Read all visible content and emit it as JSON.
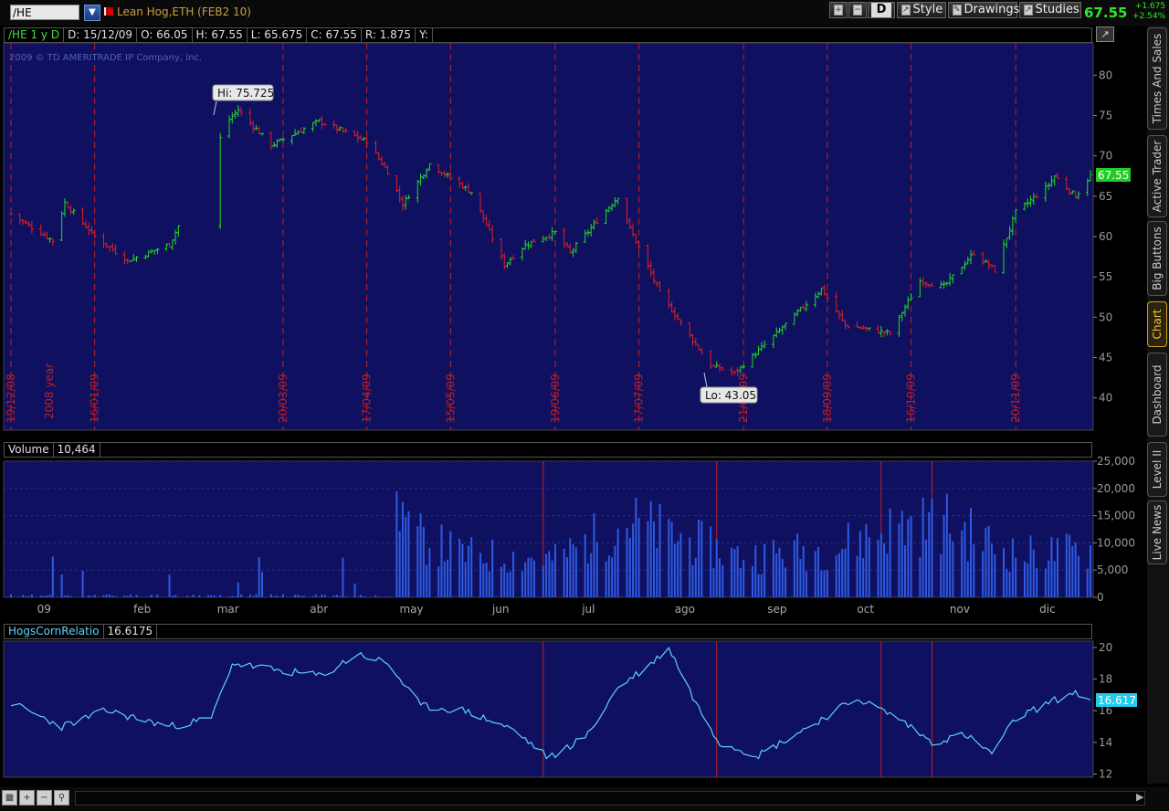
{
  "toolbar": {
    "symbol": "/HE",
    "instrument": "Lean Hog,ETH (FEB2 10)",
    "aggregation_label": "D",
    "style_label": "Style",
    "drawings_label": "Drawings",
    "studies_label": "Studies",
    "last_price": "67.55",
    "net_change": "+1.675",
    "pct_change": "+2.54%"
  },
  "price_header": {
    "symbol_period": "/HE 1 y D",
    "date": "D: 15/12/09",
    "open": "O: 66.05",
    "high": "H: 67.55",
    "low": "L: 65.675",
    "close": "C: 67.55",
    "range": "R: 1.875",
    "y": "Y:"
  },
  "copyright": "2009 © TD AMERITRADE IP Company, Inc.",
  "annotations": {
    "hi_label": "Hi: 75.725",
    "lo_label": "Lo: 43.05",
    "last_badge": "67.55",
    "ratio_badge": "16.617",
    "year_label": "2008 year"
  },
  "volume_header": {
    "label": "Volume",
    "value": "10,464"
  },
  "study_header": {
    "label": "HogsCornRelatio",
    "value": "16.6175"
  },
  "side_tabs": [
    "Times And Sales",
    "Active Trader",
    "Big Buttons",
    "Chart",
    "Dashboard",
    "Level II",
    "Live News"
  ],
  "active_side_tab": "Chart",
  "colors": {
    "panel_bg": "#0f1060",
    "up": "#22dd22",
    "down": "#e02020",
    "volume": "#2e5ae0",
    "ratio": "#5fd0ff",
    "marker": "#c02020",
    "accent": "#2ee62e"
  },
  "chart_data": [
    {
      "type": "ohlc",
      "title": "/HE 1 y D",
      "y_ticks": [
        40,
        45,
        50,
        55,
        60,
        65,
        70,
        75,
        80
      ],
      "ylim": [
        36,
        84
      ],
      "date_markers": [
        "19/12/08",
        "16/01/09",
        "20/03/09",
        "17/04/09",
        "15/05/09",
        "19/06/09",
        "17/07/09",
        "21/08/09",
        "18/09/09",
        "16/10/09",
        "20/11/09"
      ],
      "price_anchors": [
        {
          "date": "2008-12-19",
          "close": 62.8
        },
        {
          "date": "2009-01-02",
          "close": 59.5
        },
        {
          "date": "2009-01-06",
          "close": 64.2
        },
        {
          "date": "2009-01-16",
          "close": 60.0
        },
        {
          "date": "2009-01-27",
          "close": 57.0
        },
        {
          "date": "2009-02-10",
          "close": 59.0
        },
        {
          "date": "2009-03-02",
          "close": 74.5
        },
        {
          "date": "2009-03-05",
          "close": 75.725
        },
        {
          "date": "2009-03-16",
          "close": 71.3
        },
        {
          "date": "2009-04-01",
          "close": 74.3
        },
        {
          "date": "2009-04-17",
          "close": 71.8
        },
        {
          "date": "2009-04-24",
          "close": 68.0
        },
        {
          "date": "2009-04-29",
          "close": 64.0
        },
        {
          "date": "2009-05-08",
          "close": 69.0
        },
        {
          "date": "2009-05-22",
          "close": 65.5
        },
        {
          "date": "2009-06-02",
          "close": 56.5
        },
        {
          "date": "2009-06-09",
          "close": 59.0
        },
        {
          "date": "2009-06-19",
          "close": 60.5
        },
        {
          "date": "2009-06-24",
          "close": 58.0
        },
        {
          "date": "2009-07-10",
          "close": 65.0
        },
        {
          "date": "2009-07-14",
          "close": 61.0
        },
        {
          "date": "2009-07-24",
          "close": 53.0
        },
        {
          "date": "2009-08-10",
          "close": 44.0
        },
        {
          "date": "2009-08-18",
          "close": 43.05
        },
        {
          "date": "2009-09-01",
          "close": 48.0
        },
        {
          "date": "2009-09-16",
          "close": 53.5
        },
        {
          "date": "2009-09-24",
          "close": 49.0
        },
        {
          "date": "2009-10-09",
          "close": 48.0
        },
        {
          "date": "2009-10-19",
          "close": 54.5
        },
        {
          "date": "2009-10-27",
          "close": 53.8
        },
        {
          "date": "2009-11-06",
          "close": 58.0
        },
        {
          "date": "2009-11-13",
          "close": 55.8
        },
        {
          "date": "2009-11-20",
          "close": 63.0
        },
        {
          "date": "2009-11-30",
          "close": 66.0
        },
        {
          "date": "2009-12-03",
          "close": 67.5
        },
        {
          "date": "2009-12-10",
          "close": 65.0
        },
        {
          "date": "2009-12-15",
          "close": 67.55
        }
      ]
    },
    {
      "type": "bar",
      "title": "Volume",
      "y_ticks": [
        0,
        5000,
        10000,
        15000,
        20000,
        25000
      ],
      "ylim": [
        0,
        25000
      ],
      "month_labels": [
        "09",
        "feb",
        "mar",
        "abr",
        "may",
        "jun",
        "jul",
        "ago",
        "sep",
        "oct",
        "nov",
        "dic"
      ],
      "volume_anchors": [
        {
          "date": "2008-12-19",
          "value": 300
        },
        {
          "date": "2009-02-15",
          "value": 1200
        },
        {
          "date": "2009-04-22",
          "value": 3000
        },
        {
          "date": "2009-04-28",
          "value": 22500
        },
        {
          "date": "2009-05-01",
          "value": 14000
        },
        {
          "date": "2009-05-20",
          "value": 9500
        },
        {
          "date": "2009-06-19",
          "value": 8500
        },
        {
          "date": "2009-07-13",
          "value": 17000
        },
        {
          "date": "2009-08-20",
          "value": 9000
        },
        {
          "date": "2009-09-21",
          "value": 11000
        },
        {
          "date": "2009-10-12",
          "value": 16000
        },
        {
          "date": "2009-10-28",
          "value": 16500
        },
        {
          "date": "2009-11-20",
          "value": 9500
        },
        {
          "date": "2009-12-15",
          "value": 10464
        }
      ]
    },
    {
      "type": "line",
      "title": "HogsCornRelatio",
      "y_ticks": [
        12,
        14,
        16,
        18,
        20
      ],
      "ylim": [
        11.8,
        20.4
      ],
      "series": [
        {
          "name": "HogsCornRelatio",
          "points": [
            {
              "date": "2008-12-19",
              "value": 16.5
            },
            {
              "date": "2009-01-05",
              "value": 15.0
            },
            {
              "date": "2009-01-20",
              "value": 16.0
            },
            {
              "date": "2009-02-10",
              "value": 15.0
            },
            {
              "date": "2009-02-24",
              "value": 15.5
            },
            {
              "date": "2009-03-03",
              "value": 19.0
            },
            {
              "date": "2009-03-20",
              "value": 18.5
            },
            {
              "date": "2009-04-02",
              "value": 18.2
            },
            {
              "date": "2009-04-14",
              "value": 19.6
            },
            {
              "date": "2009-04-24",
              "value": 19.0
            },
            {
              "date": "2009-05-05",
              "value": 16.3
            },
            {
              "date": "2009-05-20",
              "value": 16.0
            },
            {
              "date": "2009-06-05",
              "value": 14.8
            },
            {
              "date": "2009-06-17",
              "value": 13.0
            },
            {
              "date": "2009-06-30",
              "value": 14.5
            },
            {
              "date": "2009-07-10",
              "value": 17.5
            },
            {
              "date": "2009-07-20",
              "value": 18.8
            },
            {
              "date": "2009-07-27",
              "value": 20.0
            },
            {
              "date": "2009-08-05",
              "value": 16.5
            },
            {
              "date": "2009-08-13",
              "value": 14.0
            },
            {
              "date": "2009-08-26",
              "value": 13.2
            },
            {
              "date": "2009-09-10",
              "value": 14.8
            },
            {
              "date": "2009-09-28",
              "value": 16.8
            },
            {
              "date": "2009-10-12",
              "value": 15.5
            },
            {
              "date": "2009-10-23",
              "value": 14.0
            },
            {
              "date": "2009-11-03",
              "value": 14.5
            },
            {
              "date": "2009-11-12",
              "value": 13.3
            },
            {
              "date": "2009-11-20",
              "value": 15.5
            },
            {
              "date": "2009-12-01",
              "value": 16.5
            },
            {
              "date": "2009-12-10",
              "value": 17.2
            },
            {
              "date": "2009-12-15",
              "value": 16.6175
            }
          ]
        }
      ]
    }
  ]
}
